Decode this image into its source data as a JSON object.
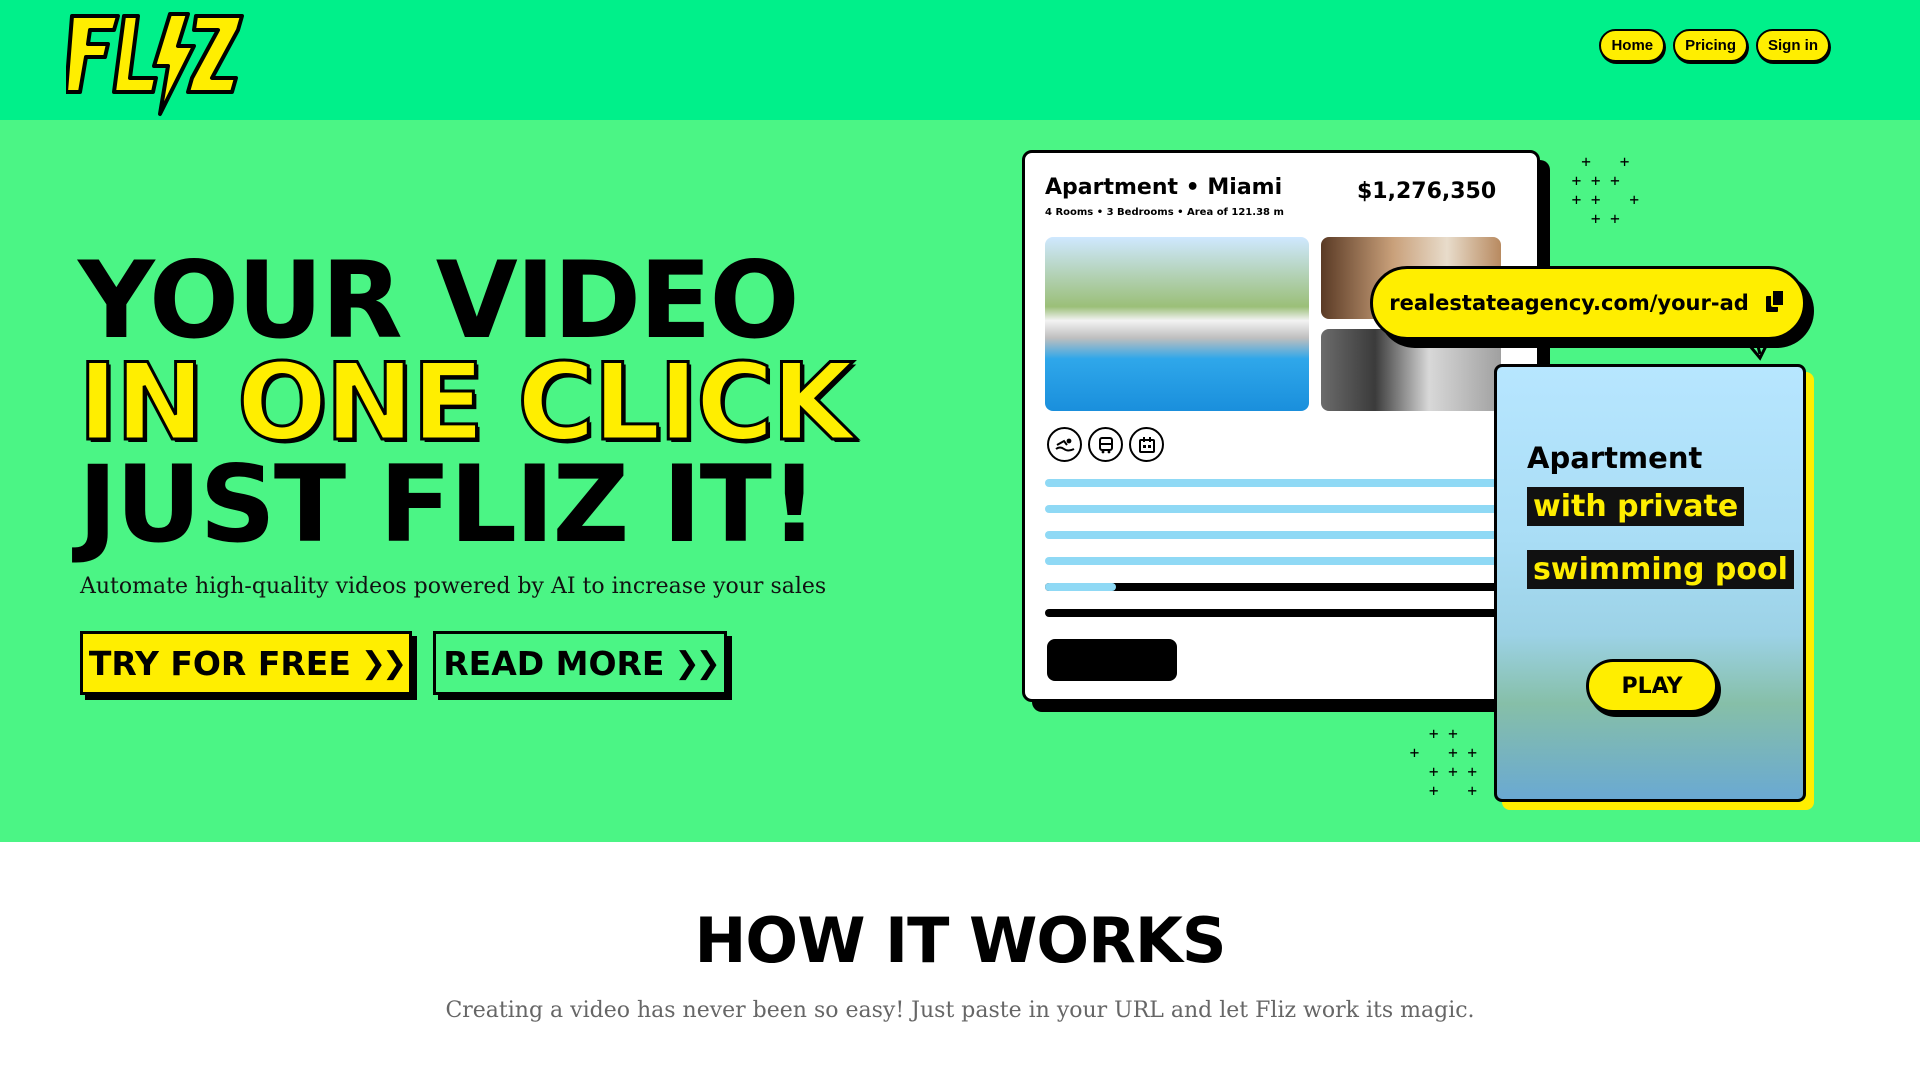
{
  "header": {
    "logo_text": "FLIZ",
    "nav": [
      "Home",
      "Pricing",
      "Sign in"
    ]
  },
  "hero": {
    "line1": "YOUR VIDEO",
    "line2": "IN ONE CLICK",
    "line3": "JUST FLIZ IT!",
    "subtitle": "Automate high-quality videos powered by AI to increase your sales",
    "primary_cta": "TRY FOR FREE",
    "secondary_cta": "READ MORE",
    "cta_icon": "double-chevron-right-icon"
  },
  "listing": {
    "title": "Apartment • Miami",
    "meta": "4 Rooms • 3 Bedrooms • Area of 121.38 m",
    "price": "$1,276,350",
    "amenity_icons": [
      "swimming-icon",
      "bus-icon",
      "calendar-icon"
    ],
    "progress": 0.15
  },
  "url_pill": {
    "text": "realestateagency.com/your-ad",
    "icon": "copy-icon"
  },
  "video": {
    "title": "Apartment",
    "highlight1": "with private",
    "highlight2": "swimming pool",
    "play_label": "PLAY"
  },
  "how": {
    "title": "HOW IT WORKS",
    "subtitle": "Creating a video has never been so easy! Just paste in your URL and let Fliz work its magic."
  },
  "colors": {
    "header_bg": "#00f08a",
    "hero_bg": "#4bf585",
    "accent_yellow": "#ffee00",
    "ink": "#000000"
  }
}
